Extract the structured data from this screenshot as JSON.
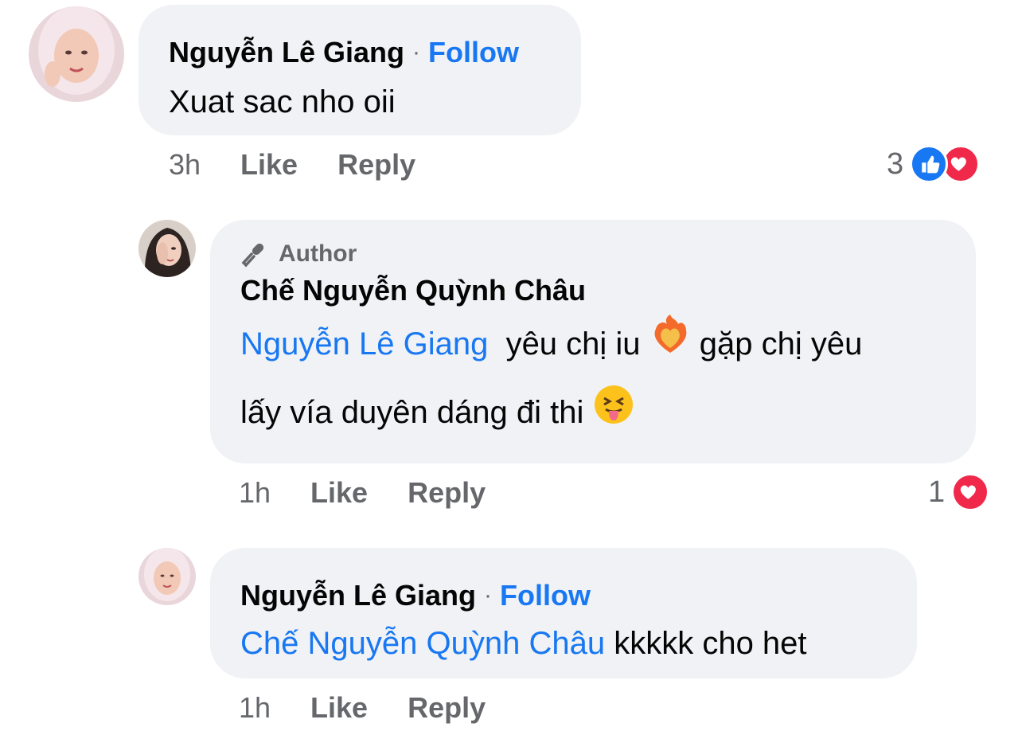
{
  "comments": [
    {
      "author": "Nguyễn Lê Giang",
      "separator": "·",
      "follow_label": "Follow",
      "text": "Xuat sac nho oii",
      "time": "3h",
      "like_label": "Like",
      "reply_label": "Reply",
      "reaction_count": "3",
      "reaction_icons": [
        "like-icon",
        "love-icon"
      ]
    },
    {
      "badge": "Author",
      "badge_icon": "microphone-icon",
      "author": "Chế Nguyễn Quỳnh Châu",
      "mention": "Nguyễn Lê Giang",
      "text_part1": "yêu chị iu",
      "text_part2": "gặp chị yêu",
      "text_part3": "lấy vía duyên dáng đi thi",
      "emojis": [
        "heart-on-fire-emoji",
        "squinting-tongue-emoji"
      ],
      "time": "1h",
      "like_label": "Like",
      "reply_label": "Reply",
      "reaction_count": "1",
      "reaction_icons": [
        "love-icon"
      ]
    },
    {
      "author": "Nguyễn Lê Giang",
      "separator": "·",
      "follow_label": "Follow",
      "mention": "Chế Nguyễn Quỳnh Châu",
      "text": "kkkkk cho het",
      "time": "1h",
      "like_label": "Like",
      "reply_label": "Reply"
    }
  ],
  "colors": {
    "link": "#1877f2",
    "bubble": "#f0f2f5",
    "meta": "#65676b",
    "like": "#1877f2",
    "love": "#f02849"
  }
}
